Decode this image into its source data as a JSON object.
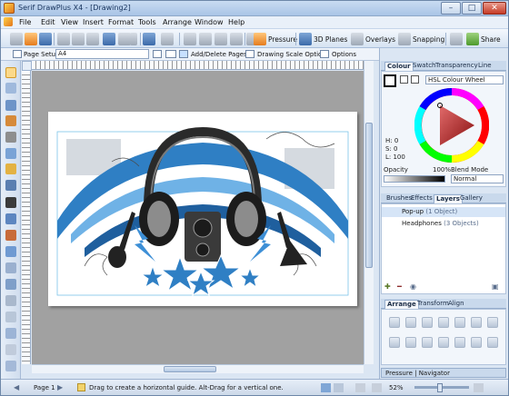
{
  "window": {
    "title": "Serif DrawPlus X4 - [Drawing2]",
    "controls": {
      "minimize": "–",
      "maximize": "□",
      "close": "✕"
    }
  },
  "menu": [
    "File",
    "Edit",
    "View",
    "Insert",
    "Format",
    "Tools",
    "Arrange",
    "Window",
    "Help"
  ],
  "toolbar": {
    "pressure": "Pressure",
    "planes": "3D Planes",
    "overlays": "Overlays",
    "snapping": "Snapping",
    "share": "Share"
  },
  "context": {
    "page_setup": "Page Setup",
    "page_size": "A4",
    "add_delete_pages": "Add/Delete Pages",
    "drawing_scale": "Drawing Scale Options",
    "options": "Options"
  },
  "colour_panel": {
    "tabs": [
      "Colour",
      "Swatch",
      "Transparency",
      "Line"
    ],
    "mode": "HSL Colour Wheel",
    "h_label": "H: 0",
    "s_label": "S: 0",
    "l_label": "L: 100",
    "opacity_label": "Opacity",
    "opacity_value": "100%",
    "blend_label": "Blend Mode",
    "blend_value": "Normal"
  },
  "layers_panel": {
    "tabs": [
      "Brushes",
      "Effects",
      "Layers",
      "Gallery"
    ],
    "rows": [
      {
        "name": "Pop-up",
        "count": "(1 Object)"
      },
      {
        "name": "Headphones",
        "count": "(3 Objects)"
      }
    ]
  },
  "arrange_panel": {
    "tabs": [
      "Arrange",
      "Transform",
      "Align"
    ],
    "bottom_tabs": "Pressure | Navigator"
  },
  "status": {
    "page": "Page 1",
    "hint": "Drag to create a horizontal guide. Alt-Drag for a vertical one.",
    "zoom": "52%"
  },
  "colors": {
    "accent": "#3a6fb3",
    "artwork_blue": "#2f7fc4",
    "artwork_dark": "#2a2a2a"
  }
}
